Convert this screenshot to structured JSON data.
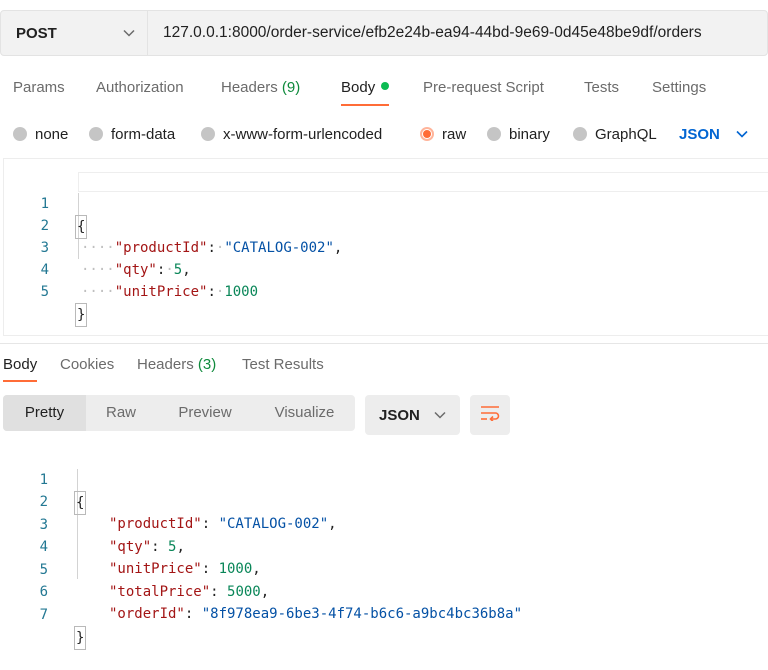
{
  "request": {
    "method": "POST",
    "url": "127.0.0.1:8000/order-service/efb2e24b-ea94-44bd-9e69-0d45e48be9df/orders"
  },
  "request_tabs": {
    "params": "Params",
    "authorization": "Authorization",
    "headers": "Headers",
    "headers_count": "(9)",
    "body": "Body",
    "prerequest": "Pre-request Script",
    "tests": "Tests",
    "settings": "Settings"
  },
  "body_types": {
    "none": "none",
    "form_data": "form-data",
    "urlencoded": "x-www-form-urlencoded",
    "raw": "raw",
    "binary": "binary",
    "graphql": "GraphQL",
    "selected": "raw"
  },
  "raw_format": "JSON",
  "request_body": {
    "line_numbers": [
      "1",
      "2",
      "3",
      "4",
      "5"
    ],
    "open": "{",
    "close": "}",
    "fields": [
      {
        "key": "\"productId\"",
        "value": "\"CATALOG-002\"",
        "trail": ","
      },
      {
        "key": "\"qty\"",
        "value": "5",
        "trail": ","
      },
      {
        "key": "\"unitPrice\"",
        "value": "1000",
        "trail": ""
      }
    ]
  },
  "response_tabs": {
    "body": "Body",
    "cookies": "Cookies",
    "headers": "Headers",
    "headers_count": "(3)",
    "test_results": "Test Results"
  },
  "response_views": {
    "pretty": "Pretty",
    "raw": "Raw",
    "preview": "Preview",
    "visualize": "Visualize"
  },
  "response_format": "JSON",
  "response_body": {
    "line_numbers": [
      "1",
      "2",
      "3",
      "4",
      "5",
      "6",
      "7"
    ],
    "open": "{",
    "close": "}",
    "fields": [
      {
        "key": "\"productId\"",
        "value": "\"CATALOG-002\"",
        "trail": ","
      },
      {
        "key": "\"qty\"",
        "value": "5",
        "trail": ","
      },
      {
        "key": "\"unitPrice\"",
        "value": "1000",
        "trail": ","
      },
      {
        "key": "\"totalPrice\"",
        "value": "5000",
        "trail": ","
      },
      {
        "key": "\"orderId\"",
        "value": "\"8f978ea9-6be3-4f74-b6c6-a9bc4bc36b8a\"",
        "trail": ""
      }
    ]
  },
  "colors": {
    "accent": "#ff6c37",
    "link": "#0265d2",
    "count_green": "#0f8a3c",
    "json_key": "#a31515",
    "json_string": "#0451a5",
    "json_number": "#098658"
  }
}
